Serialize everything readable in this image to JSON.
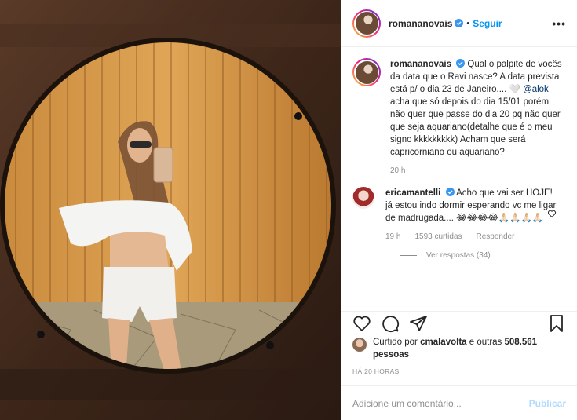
{
  "header": {
    "username": "romananovais",
    "follow_label": "Seguir",
    "dot": "•",
    "more_label": "•••"
  },
  "caption": {
    "username": "romananovais",
    "text_before_mention": "Qual o palpite de vocês da data que o Ravi nasce? A data prevista está p/ o dia 23 de Janeiro.... 🤍 ",
    "mention": "@alok",
    "text_after_mention": " acha que só depois do dia 15/01 porém não quer que passe do dia 20 pq não quer que seja aquariano(detalhe que é o meu signo kkkkkkkkk) Acham que será capricorniano ou aquariano?",
    "time": "20 h"
  },
  "comment": {
    "username": "ericamantelli",
    "text": "Acho que vai ser HOJE! já estou indo dormir esperando vc me ligar de madrugada.... 😂😂😂😂🙏🏻🙏🏻🙏🏻🙏🏻",
    "time": "19 h",
    "likes": "1593 curtidas",
    "reply": "Responder",
    "view_replies": "Ver respostas (34)"
  },
  "likes": {
    "prefix": "Curtido por ",
    "user": "cmalavolta",
    "suffix": " e outras ",
    "count": "508.561 pessoas"
  },
  "timestamp": "HÁ 20 HORAS",
  "add_comment": {
    "placeholder": "Adicione um comentário...",
    "publish_label": "Publicar"
  },
  "colors": {
    "accent": "#0095f6",
    "verified": "#3897f0",
    "muted": "#8e8e8e"
  },
  "icons": [
    "verified-badge-icon",
    "more-options-icon",
    "like-heart-icon",
    "comment-icon",
    "share-icon",
    "save-bookmark-icon",
    "comment-like-icon"
  ]
}
